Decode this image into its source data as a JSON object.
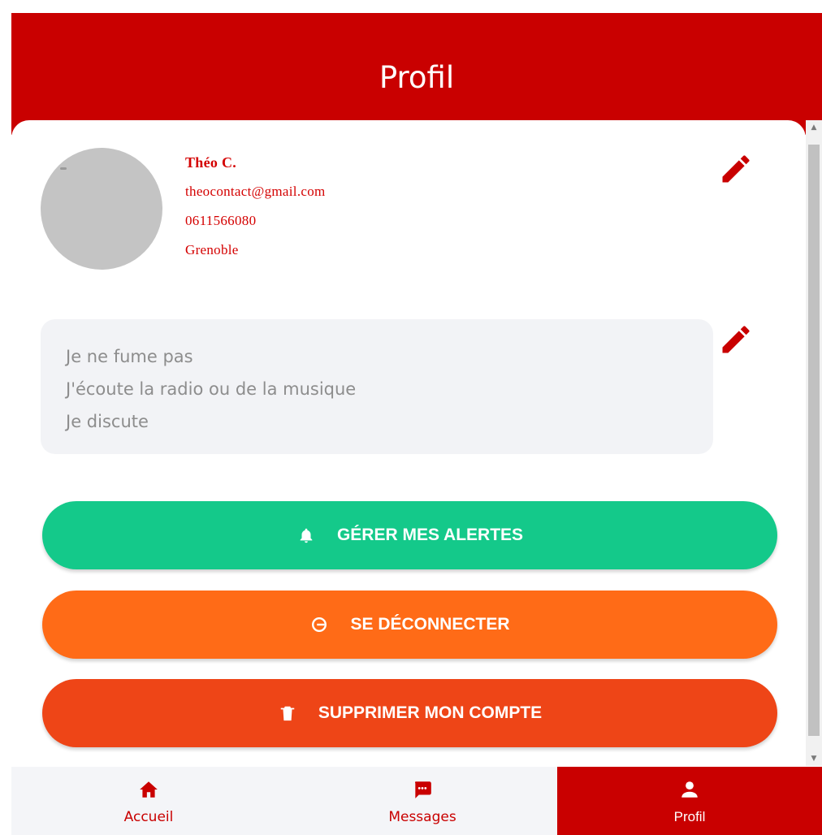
{
  "header": {
    "title": "Profil"
  },
  "user": {
    "name": "Théo C.",
    "email": "theocontact@gmail.com",
    "phone": "0611566080",
    "city": "Grenoble"
  },
  "bio": {
    "lines": [
      "Je ne fume pas",
      "J'écoute la radio ou de la musique",
      "Je discute"
    ]
  },
  "actions": {
    "alerts": {
      "label": "GÉRER MES ALERTES",
      "icon": "bell-icon",
      "color": "#14c98a"
    },
    "logout": {
      "label": "SE DÉCONNECTER",
      "icon": "logout-icon",
      "color": "#ff6b17"
    },
    "delete": {
      "label": "SUPPRIMER MON COMPTE",
      "icon": "trash-icon",
      "color": "#ee4517"
    }
  },
  "nav": {
    "items": [
      {
        "label": "Accueil",
        "icon": "home-icon"
      },
      {
        "label": "Messages",
        "icon": "chat-icon"
      },
      {
        "label": "Profil",
        "icon": "user-icon",
        "active": true
      }
    ]
  },
  "colors": {
    "brand": "#c90000",
    "bio_bg": "#f2f3f6"
  }
}
